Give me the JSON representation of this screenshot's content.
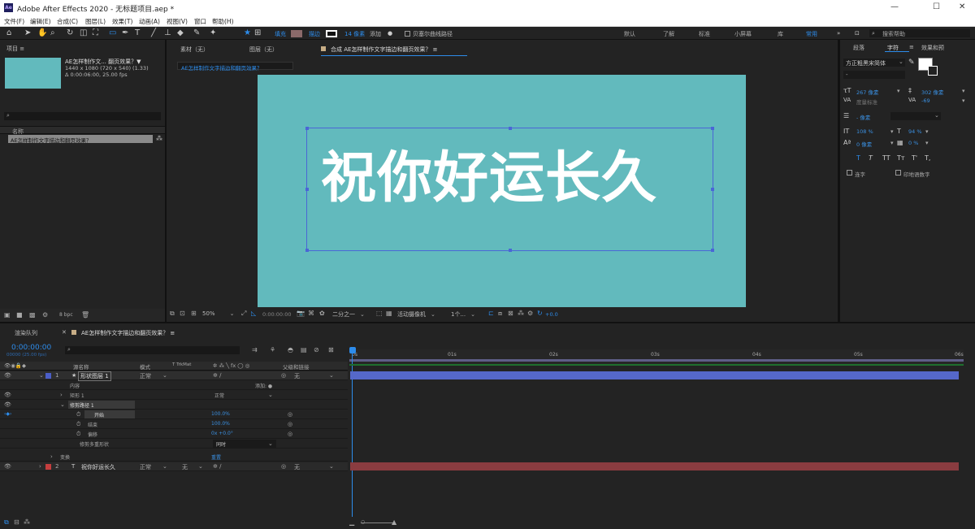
{
  "window": {
    "title": "Adobe After Effects 2020 - 无标题项目.aep *",
    "icon": "Ae",
    "minimize": "—",
    "maximize": "☐",
    "close": "✕"
  },
  "menu": [
    "文件(F)",
    "编辑(E)",
    "合成(C)",
    "图层(L)",
    "效果(T)",
    "动画(A)",
    "视图(V)",
    "窗口",
    "帮助(H)"
  ],
  "toolbar": {
    "fill_label": "填充",
    "stroke_label": "描边",
    "stroke_width": "14 像素",
    "add_label": "添加",
    "bezier_label": "贝塞尔曲线路径"
  },
  "workspaces": [
    "默认",
    "了解",
    "标准",
    "小屏幕",
    "库",
    "常用"
  ],
  "search_help": "搜索帮助",
  "project": {
    "tab": "项目 ≡",
    "comp_name": "AE怎样制作文... 翻页效果？▼",
    "comp_info1": "1440 x 1080 (720 x 540) (1.33)",
    "comp_info2": "Δ 0:00:06:00, 25.00 fps",
    "name_col": "名称",
    "item": "AE怎样制作文字描边和翻页效果？",
    "bpc": "8 bpc"
  },
  "viewer": {
    "tab_footage": "素材（无）",
    "tab_layer": "图层（无）",
    "tab_comp": "合成 AE怎样制作文字描边和翻页效果？ ≡",
    "breadcrumb": "AE怎样制作文字描边和翻页效果？",
    "main_text": "祝你好运长久",
    "zoom": "50%",
    "timecode": "0:00:00:00",
    "resolution": "二分之一",
    "camera": "活动摄像机",
    "views": "1个...",
    "exposure": "+0.0"
  },
  "right": {
    "tab_para": "段落",
    "tab_char": "字符",
    "tab_fx": "效果和预",
    "font": "方正粗黑宋简体",
    "font_style": "-",
    "size": "267 像素",
    "leading": "302 像素",
    "kerning": "度量标准",
    "tracking": "-69",
    "stroke_w": "- 像素",
    "vscale": "108 %",
    "hscale": "94 %",
    "baseline": "0 像素",
    "tsume": "0 %",
    "styles": [
      "T",
      "T",
      "TT",
      "Tт",
      "T'",
      "T,"
    ],
    "ligature": "连字",
    "hindi": "印地语数字"
  },
  "timeline": {
    "render_tab": "渲染队列",
    "comp_tab": "AE怎样制作文字描边和翻页效果？ ≡",
    "timecode": "0:00:00:00",
    "timecode_sub": "00000 (25.00 fps)",
    "cols": {
      "name": "源名称",
      "mode": "模式",
      "trkmat": "T TrkMat",
      "parent": "父级和链接"
    },
    "ruler": [
      "0s",
      "01s",
      "02s",
      "03s",
      "04s",
      "05s",
      "06s"
    ],
    "layers": [
      {
        "num": "1",
        "icon": "★",
        "name": "形状图层 1",
        "mode": "正常",
        "parent": "无"
      },
      {
        "num": "2",
        "icon": "T",
        "name": "祝你好运长久",
        "mode": "正常",
        "trk": "无",
        "parent": "无"
      }
    ],
    "props": {
      "content": "内容",
      "add": "添加: ●",
      "rect": "矩形 1",
      "rect_mode": "正常",
      "trim": "修剪路径 1",
      "start": "开始",
      "start_val": "100.0%",
      "end": "结束",
      "end_val": "100.0%",
      "offset": "偏移",
      "offset_val": "0x +0.0°",
      "multi": "修剪多重形状",
      "multi_val": "同时",
      "transform": "变换",
      "reset": "重置"
    }
  }
}
